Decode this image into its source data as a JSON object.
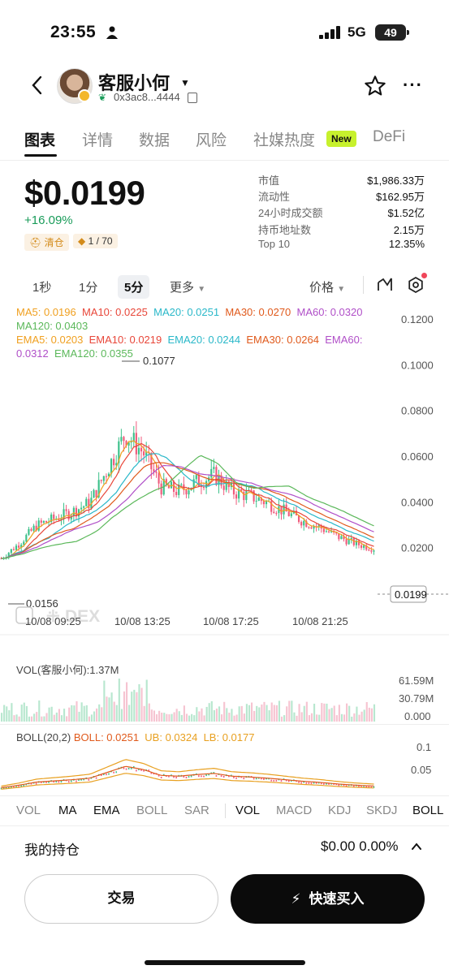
{
  "status": {
    "time": "23:55",
    "network": "5G",
    "battery": "49"
  },
  "header": {
    "token_name": "客服小何",
    "address": "0x3ac8...4444"
  },
  "tabs": [
    {
      "label": "图表"
    },
    {
      "label": "详情"
    },
    {
      "label": "数据"
    },
    {
      "label": "风险"
    },
    {
      "label": "社媒热度"
    },
    {
      "label": "DeFi"
    }
  ],
  "new_badge": "New",
  "price": {
    "value": "$0.0199",
    "change": "+16.09%",
    "tag_clear": "清仓",
    "tag_rank": "1 / 70"
  },
  "stats": [
    {
      "k": "市值",
      "v": "$1,986.33万"
    },
    {
      "k": "流动性",
      "v": "$162.95万"
    },
    {
      "k": "24小时成交额",
      "v": "$1.52亿"
    },
    {
      "k": "持币地址数",
      "v": "2.15万"
    },
    {
      "k": "Top 10",
      "v": "12.35%"
    }
  ],
  "intervals": {
    "i1": "1秒",
    "i2": "1分",
    "i3": "5分",
    "more": "更多",
    "price": "价格"
  },
  "ma_line": {
    "ma5": "MA5: 0.0196",
    "ma10": "MA10: 0.0225",
    "ma20": "MA20: 0.0251",
    "ma30": "MA30: 0.0270",
    "ma60": "MA60: 0.0320",
    "ma120": "MA120: 0.0403",
    "ema5": "EMA5: 0.0203",
    "ema10": "EMA10: 0.0219",
    "ema20": "EMA20: 0.0244",
    "ema30": "EMA30: 0.0264",
    "ema60": "EMA60:",
    "ema60v": "0.0312",
    "ema120": "EMA120: 0.0355"
  },
  "colors": {
    "ma5": "#f0a020",
    "ma10": "#e8473a",
    "ma20": "#2ab8c9",
    "ma30": "#e05a1c",
    "ma60": "#b04fc8",
    "ma120": "#5bb85a",
    "up": "#3cc08a",
    "down": "#ef5b7c"
  },
  "chart_data": {
    "type": "line",
    "title": "",
    "y_ticks": [
      "0.1200",
      "0.1000",
      "0.0800",
      "0.0600",
      "0.0400",
      "0.0200"
    ],
    "ylim": [
      0.0,
      0.12
    ],
    "x_ticks": [
      "10/08 09:25",
      "10/08 13:25",
      "10/08 17:25",
      "10/08 21:25"
    ],
    "high_label": "0.1077",
    "low_label": "0.0156",
    "last_price": "0.0199",
    "watermark": "DEX",
    "series": [
      {
        "name": "price",
        "values": [
          0.0156,
          0.022,
          0.03,
          0.033,
          0.036,
          0.04,
          0.055,
          0.07,
          0.062,
          0.047,
          0.045,
          0.049,
          0.052,
          0.045,
          0.043,
          0.04,
          0.036,
          0.032,
          0.029,
          0.025,
          0.022,
          0.0199
        ]
      }
    ]
  },
  "vol": {
    "label": "VOL(客服小何):1.37M",
    "ticks": [
      "61.59M",
      "30.79M",
      "0.000"
    ]
  },
  "boll": {
    "label": "BOLL(20,2)",
    "boll": "BOLL: 0.0251",
    "ub": "UB: 0.0324",
    "lb": "LB: 0.0177",
    "ticks": [
      "0.1",
      "0.05"
    ]
  },
  "indicator_tabs": [
    {
      "label": "VOL",
      "on": false
    },
    {
      "label": "MA",
      "on": true
    },
    {
      "label": "EMA",
      "on": true
    },
    {
      "label": "BOLL",
      "on": false
    },
    {
      "label": "SAR",
      "on": false
    },
    {
      "label": "VOL",
      "on": true
    },
    {
      "label": "MACD",
      "on": false
    },
    {
      "label": "KDJ",
      "on": false
    },
    {
      "label": "SKDJ",
      "on": false
    },
    {
      "label": "BOLL",
      "on": true
    }
  ],
  "position": {
    "label": "我的持仓",
    "value": "$0.00 0.00%"
  },
  "buttons": {
    "trade": "交易",
    "quick_buy": "快速买入"
  }
}
